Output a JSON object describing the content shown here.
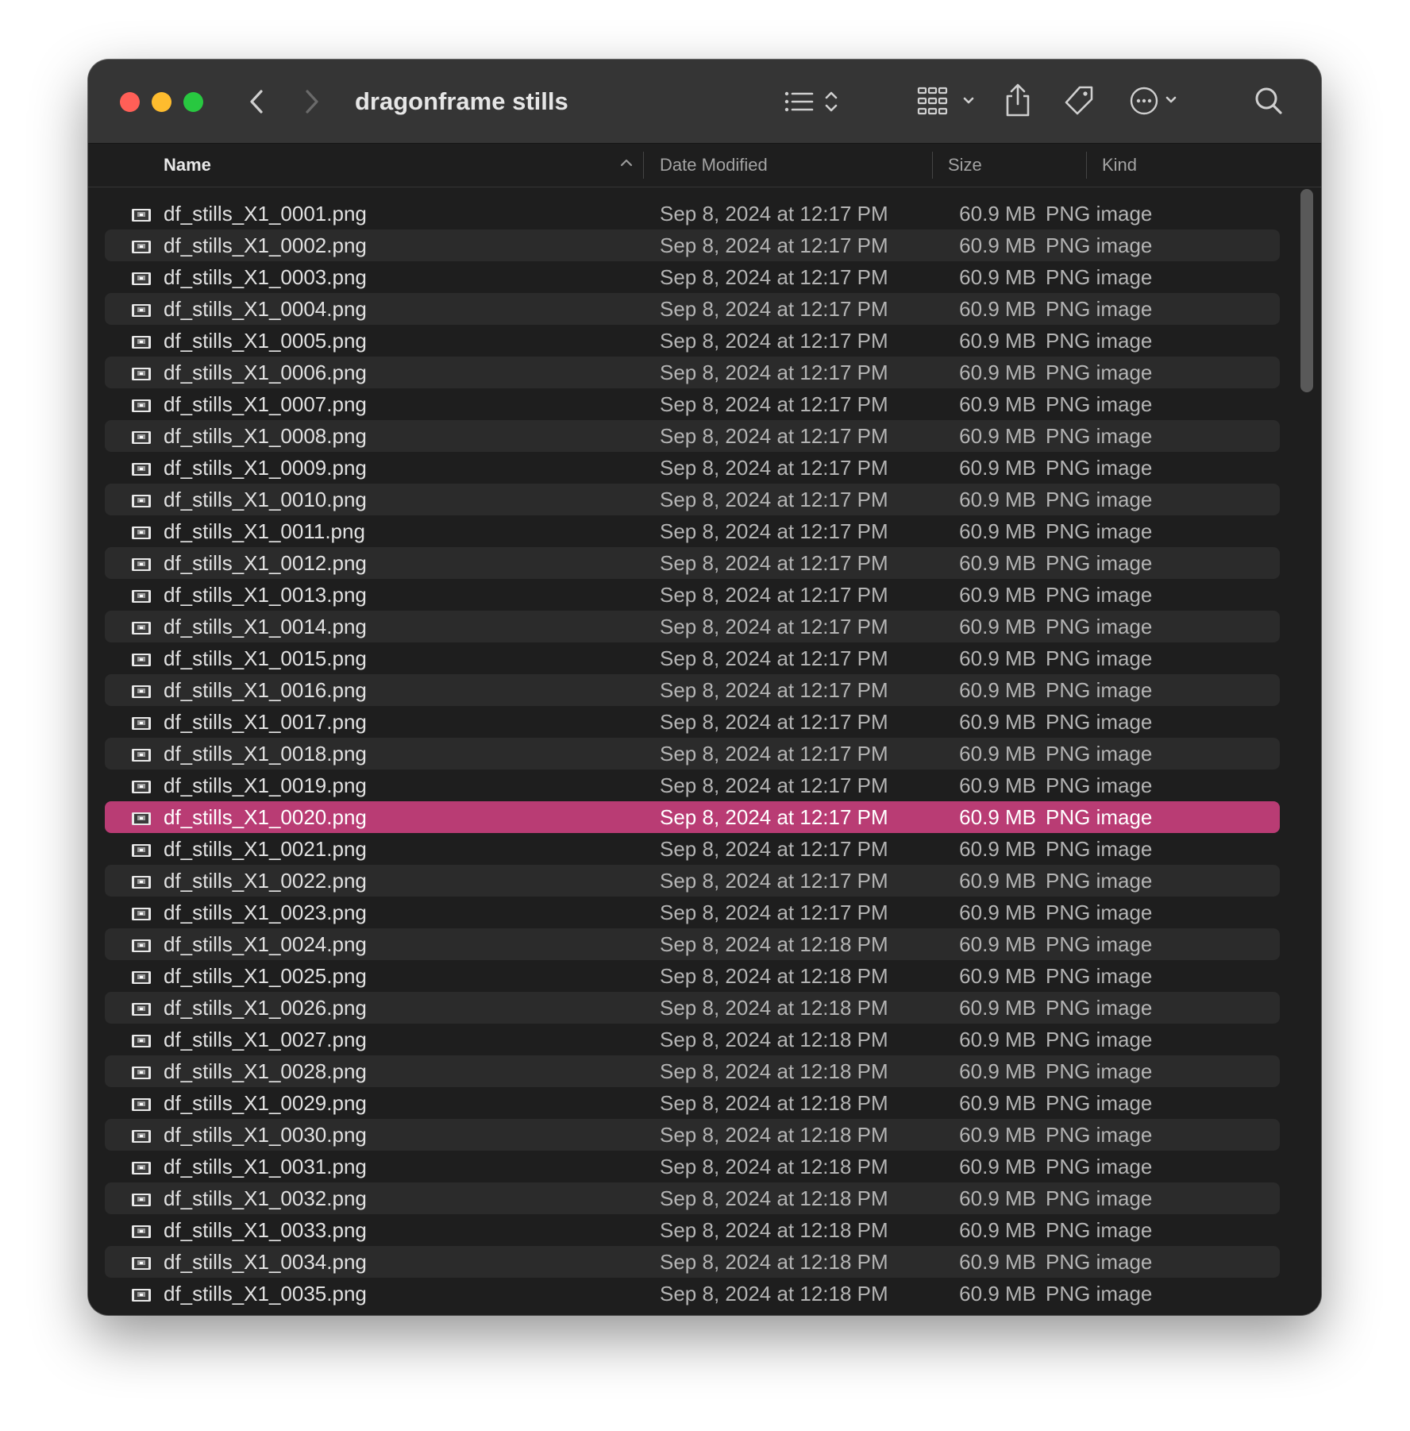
{
  "window": {
    "title": "dragonframe stills"
  },
  "toolbar": {
    "back_icon": "chevron-left-icon",
    "forward_icon": "chevron-right-icon",
    "view_icon": "list-view-icon",
    "group_icon": "grid-group-icon",
    "share_icon": "share-icon",
    "tag_icon": "tag-icon",
    "more_icon": "ellipsis-circle-icon",
    "search_icon": "search-icon"
  },
  "columns": {
    "name": "Name",
    "date": "Date Modified",
    "size": "Size",
    "kind": "Kind"
  },
  "colors": {
    "selection": "#b93c74"
  },
  "files": [
    {
      "name": "df_stills_X1_0001.png",
      "date": "Sep 8, 2024 at 12:17 PM",
      "size": "60.9 MB",
      "kind": "PNG image"
    },
    {
      "name": "df_stills_X1_0002.png",
      "date": "Sep 8, 2024 at 12:17 PM",
      "size": "60.9 MB",
      "kind": "PNG image"
    },
    {
      "name": "df_stills_X1_0003.png",
      "date": "Sep 8, 2024 at 12:17 PM",
      "size": "60.9 MB",
      "kind": "PNG image"
    },
    {
      "name": "df_stills_X1_0004.png",
      "date": "Sep 8, 2024 at 12:17 PM",
      "size": "60.9 MB",
      "kind": "PNG image"
    },
    {
      "name": "df_stills_X1_0005.png",
      "date": "Sep 8, 2024 at 12:17 PM",
      "size": "60.9 MB",
      "kind": "PNG image"
    },
    {
      "name": "df_stills_X1_0006.png",
      "date": "Sep 8, 2024 at 12:17 PM",
      "size": "60.9 MB",
      "kind": "PNG image"
    },
    {
      "name": "df_stills_X1_0007.png",
      "date": "Sep 8, 2024 at 12:17 PM",
      "size": "60.9 MB",
      "kind": "PNG image"
    },
    {
      "name": "df_stills_X1_0008.png",
      "date": "Sep 8, 2024 at 12:17 PM",
      "size": "60.9 MB",
      "kind": "PNG image"
    },
    {
      "name": "df_stills_X1_0009.png",
      "date": "Sep 8, 2024 at 12:17 PM",
      "size": "60.9 MB",
      "kind": "PNG image"
    },
    {
      "name": "df_stills_X1_0010.png",
      "date": "Sep 8, 2024 at 12:17 PM",
      "size": "60.9 MB",
      "kind": "PNG image"
    },
    {
      "name": "df_stills_X1_0011.png",
      "date": "Sep 8, 2024 at 12:17 PM",
      "size": "60.9 MB",
      "kind": "PNG image"
    },
    {
      "name": "df_stills_X1_0012.png",
      "date": "Sep 8, 2024 at 12:17 PM",
      "size": "60.9 MB",
      "kind": "PNG image"
    },
    {
      "name": "df_stills_X1_0013.png",
      "date": "Sep 8, 2024 at 12:17 PM",
      "size": "60.9 MB",
      "kind": "PNG image"
    },
    {
      "name": "df_stills_X1_0014.png",
      "date": "Sep 8, 2024 at 12:17 PM",
      "size": "60.9 MB",
      "kind": "PNG image"
    },
    {
      "name": "df_stills_X1_0015.png",
      "date": "Sep 8, 2024 at 12:17 PM",
      "size": "60.9 MB",
      "kind": "PNG image"
    },
    {
      "name": "df_stills_X1_0016.png",
      "date": "Sep 8, 2024 at 12:17 PM",
      "size": "60.9 MB",
      "kind": "PNG image"
    },
    {
      "name": "df_stills_X1_0017.png",
      "date": "Sep 8, 2024 at 12:17 PM",
      "size": "60.9 MB",
      "kind": "PNG image"
    },
    {
      "name": "df_stills_X1_0018.png",
      "date": "Sep 8, 2024 at 12:17 PM",
      "size": "60.9 MB",
      "kind": "PNG image"
    },
    {
      "name": "df_stills_X1_0019.png",
      "date": "Sep 8, 2024 at 12:17 PM",
      "size": "60.9 MB",
      "kind": "PNG image"
    },
    {
      "name": "df_stills_X1_0020.png",
      "date": "Sep 8, 2024 at 12:17 PM",
      "size": "60.9 MB",
      "kind": "PNG image",
      "selected": true
    },
    {
      "name": "df_stills_X1_0021.png",
      "date": "Sep 8, 2024 at 12:17 PM",
      "size": "60.9 MB",
      "kind": "PNG image"
    },
    {
      "name": "df_stills_X1_0022.png",
      "date": "Sep 8, 2024 at 12:17 PM",
      "size": "60.9 MB",
      "kind": "PNG image"
    },
    {
      "name": "df_stills_X1_0023.png",
      "date": "Sep 8, 2024 at 12:17 PM",
      "size": "60.9 MB",
      "kind": "PNG image"
    },
    {
      "name": "df_stills_X1_0024.png",
      "date": "Sep 8, 2024 at 12:18 PM",
      "size": "60.9 MB",
      "kind": "PNG image"
    },
    {
      "name": "df_stills_X1_0025.png",
      "date": "Sep 8, 2024 at 12:18 PM",
      "size": "60.9 MB",
      "kind": "PNG image"
    },
    {
      "name": "df_stills_X1_0026.png",
      "date": "Sep 8, 2024 at 12:18 PM",
      "size": "60.9 MB",
      "kind": "PNG image"
    },
    {
      "name": "df_stills_X1_0027.png",
      "date": "Sep 8, 2024 at 12:18 PM",
      "size": "60.9 MB",
      "kind": "PNG image"
    },
    {
      "name": "df_stills_X1_0028.png",
      "date": "Sep 8, 2024 at 12:18 PM",
      "size": "60.9 MB",
      "kind": "PNG image"
    },
    {
      "name": "df_stills_X1_0029.png",
      "date": "Sep 8, 2024 at 12:18 PM",
      "size": "60.9 MB",
      "kind": "PNG image"
    },
    {
      "name": "df_stills_X1_0030.png",
      "date": "Sep 8, 2024 at 12:18 PM",
      "size": "60.9 MB",
      "kind": "PNG image"
    },
    {
      "name": "df_stills_X1_0031.png",
      "date": "Sep 8, 2024 at 12:18 PM",
      "size": "60.9 MB",
      "kind": "PNG image"
    },
    {
      "name": "df_stills_X1_0032.png",
      "date": "Sep 8, 2024 at 12:18 PM",
      "size": "60.9 MB",
      "kind": "PNG image"
    },
    {
      "name": "df_stills_X1_0033.png",
      "date": "Sep 8, 2024 at 12:18 PM",
      "size": "60.9 MB",
      "kind": "PNG image"
    },
    {
      "name": "df_stills_X1_0034.png",
      "date": "Sep 8, 2024 at 12:18 PM",
      "size": "60.9 MB",
      "kind": "PNG image"
    },
    {
      "name": "df_stills_X1_0035.png",
      "date": "Sep 8, 2024 at 12:18 PM",
      "size": "60.9 MB",
      "kind": "PNG image"
    }
  ]
}
